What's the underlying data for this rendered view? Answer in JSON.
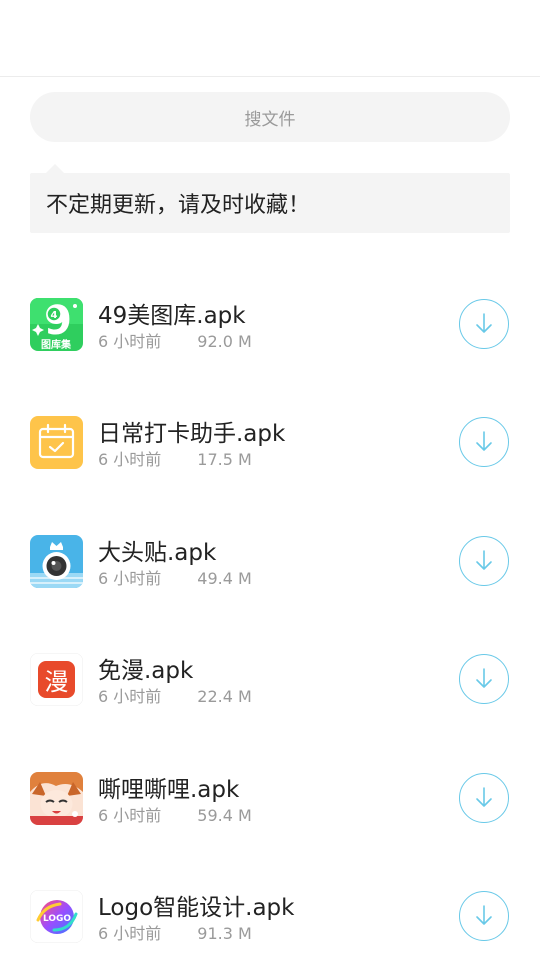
{
  "search": {
    "placeholder": "搜文件"
  },
  "notice": {
    "text": "不定期更新，请及时收藏！"
  },
  "files": [
    {
      "name": "49美图库.apk",
      "time": "6 小时前",
      "size": "92.0 M",
      "icon": "gallery-icon"
    },
    {
      "name": "日常打卡助手.apk",
      "time": "6 小时前",
      "size": "17.5 M",
      "icon": "calendar-check-icon"
    },
    {
      "name": "大头贴.apk",
      "time": "6 小时前",
      "size": "49.4 M",
      "icon": "camera-icon"
    },
    {
      "name": "免漫.apk",
      "time": "6 小时前",
      "size": "22.4 M",
      "icon": "manga-icon"
    },
    {
      "name": "嘶哩嘶哩.apk",
      "time": "6 小时前",
      "size": "59.4 M",
      "icon": "anime-character-icon"
    },
    {
      "name": "Logo智能设计.apk",
      "time": "6 小时前",
      "size": "91.3 M",
      "icon": "logo-design-icon"
    }
  ],
  "icon_text": {
    "gallery_digit": "9",
    "gallery_sub": "4",
    "gallery_caption": "图库集",
    "manga_char": "漫",
    "logo_word": "LOGO"
  },
  "colors": {
    "accent": "#69c9e8",
    "text_primary": "#222222",
    "text_secondary": "#9a9a9a",
    "field_bg": "#f4f4f4"
  }
}
